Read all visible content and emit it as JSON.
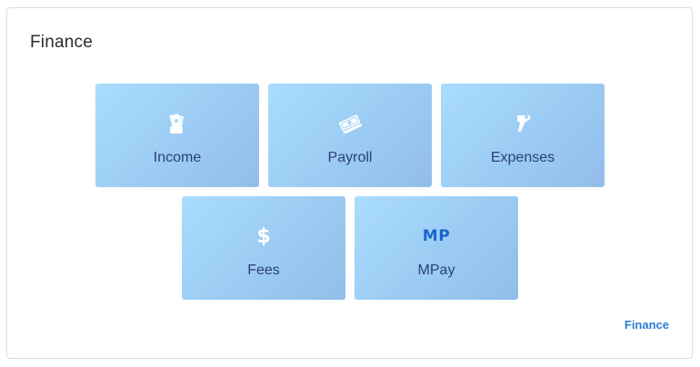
{
  "card": {
    "title": "Finance",
    "footer_link": "Finance"
  },
  "tiles": [
    {
      "label": "Income",
      "icon": "money-hand-icon"
    },
    {
      "label": "Payroll",
      "icon": "cash-stack-icon"
    },
    {
      "label": "Expenses",
      "icon": "hand-coin-icon"
    },
    {
      "label": "Fees",
      "icon": "dollar-icon",
      "icon_text": "$"
    },
    {
      "label": "MPay",
      "icon": "mpay-logo-icon",
      "icon_text": "MP"
    }
  ],
  "colors": {
    "tile_gradient_start": "#aadcff",
    "tile_gradient_end": "#93bde9",
    "tile_label": "#2c3f7a",
    "mp_icon": "#1a66cc",
    "link": "#2a7fd4"
  }
}
